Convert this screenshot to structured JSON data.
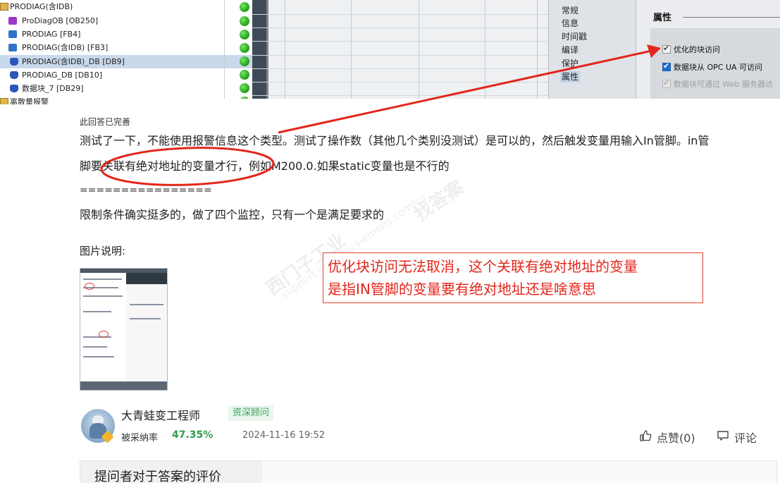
{
  "tia": {
    "tree": [
      {
        "label": "PRODIAG(含IDB)",
        "icon": "folder-icon",
        "selected": false
      },
      {
        "label": "ProDiagOB [OB250]",
        "icon": "ob-block-icon",
        "selected": false
      },
      {
        "label": "PRODIAG [FB4]",
        "icon": "fb-block-icon",
        "selected": false
      },
      {
        "label": "PRODIAG(含IDB) [FB3]",
        "icon": "fb-block-icon",
        "selected": false
      },
      {
        "label": "PRODIAG(含IDB)_DB [DB9]",
        "icon": "db-block-icon",
        "selected": true
      },
      {
        "label": "PRODIAG_DB [DB10]",
        "icon": "db-block-icon",
        "selected": false
      },
      {
        "label": "数据块_7 [DB29]",
        "icon": "db-block-icon",
        "selected": false
      },
      {
        "label": "离散量报警",
        "icon": "folder-icon",
        "selected": false
      }
    ],
    "nav": [
      "常规",
      "信息",
      "时间戳",
      "编译",
      "保护",
      "属性"
    ],
    "nav_active": "属性",
    "props_title": "属性",
    "checkboxes": [
      {
        "label": "优化的块访问",
        "state": "checked-grey"
      },
      {
        "label": "数据块从 OPC UA 可访问",
        "state": "checked-blue"
      },
      {
        "label": "数据块可通过 Web 服务器访",
        "state": "disabled"
      }
    ]
  },
  "answer": {
    "status_tag": "此回答已完善",
    "lines": [
      "测试了一下，不能使用报警信息这个类型。测试了操作数（其他几个类别没测试）是可以的，然后触发变量用输入In管脚。in管",
      "脚要关联有绝对地址的变量才行，例如M200.0.如果static变量也是不行的",
      "================",
      "限制条件确实挺多的，做了四个监控，只有一个是满足要求的"
    ],
    "image_caption": "图片说明:",
    "callout": [
      "优化块访问无法取消，这个关联有绝对地址的变量",
      "是指IN管脚的变量要有绝对地址还是啥意思"
    ],
    "watermark": [
      "西门子工业",
      "找答案",
      "support.industry.siemens.com/cs"
    ]
  },
  "author": {
    "name": "大青蛙变工程师",
    "title": "资深顾问",
    "accept_label": "被采纳率",
    "accept_rate": "47.35%",
    "time": "2024-11-16 19:52",
    "like_label": "点赞(0)",
    "comment_label": "评论"
  },
  "evaluation": {
    "title": "提问者对于答案的评价"
  },
  "colors": {
    "annotation_red": "#e3261b",
    "accent_green": "#2f9e4a",
    "status_green": "#22a31a"
  }
}
